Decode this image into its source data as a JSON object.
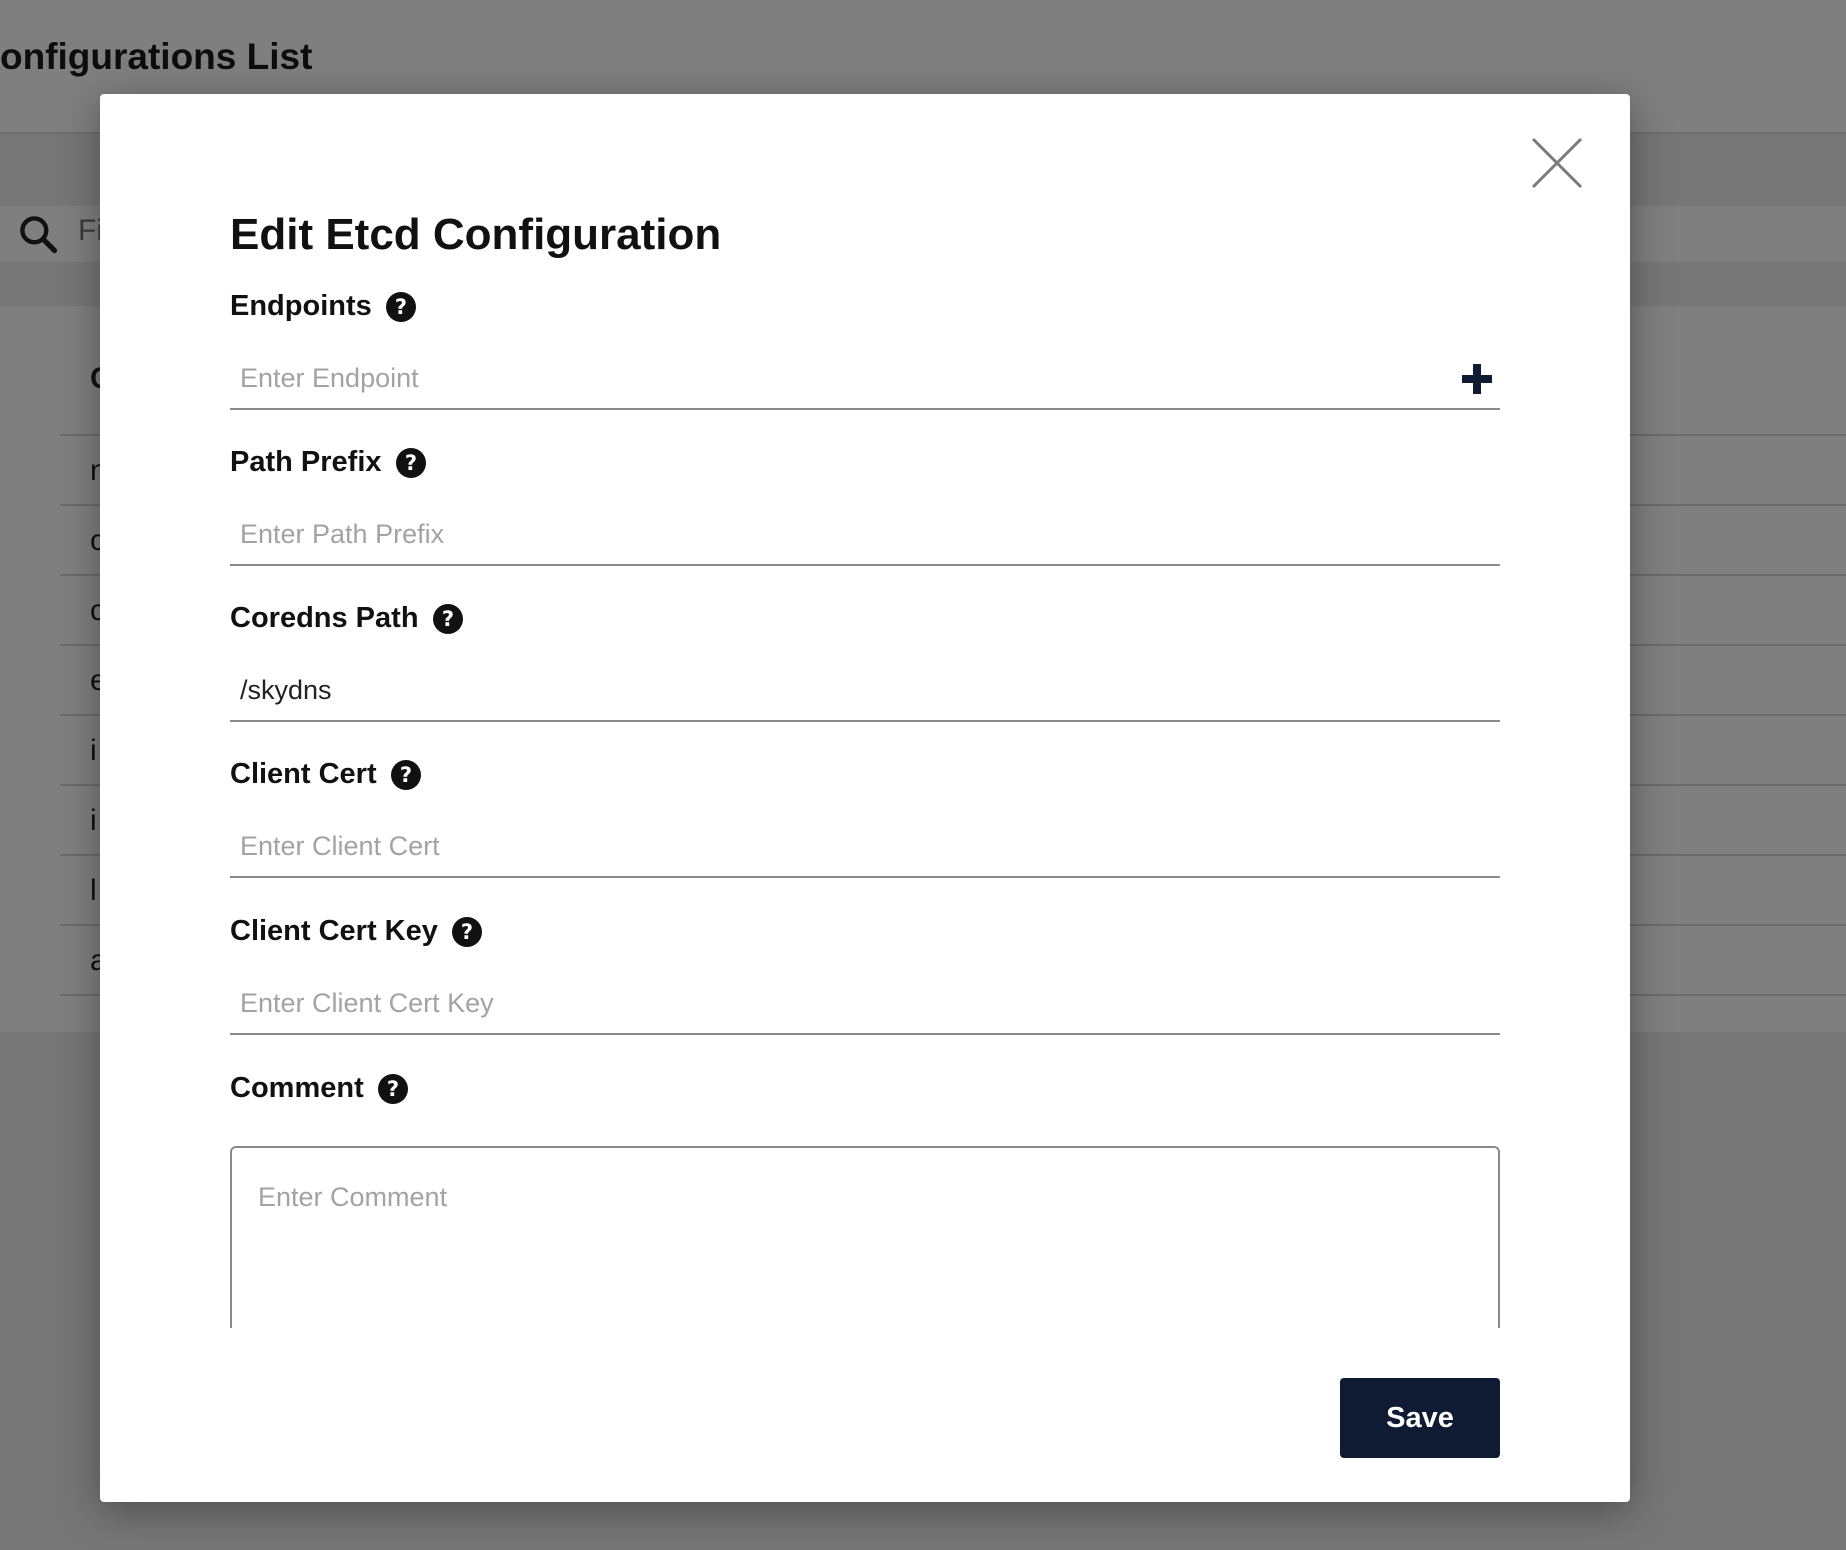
{
  "background": {
    "page_title": "onfigurations List",
    "search_placeholder": "Fi",
    "column_header": "C",
    "row_initials": [
      "n",
      "c",
      "c",
      "e",
      "i",
      "i",
      "l",
      "a"
    ]
  },
  "modal": {
    "title": "Edit Etcd Configuration",
    "close_icon": "close-icon",
    "save_label": "Save",
    "fields": {
      "endpoints": {
        "label": "Endpoints",
        "placeholder": "Enter Endpoint",
        "value": "",
        "add_icon": "plus-icon"
      },
      "path_prefix": {
        "label": "Path Prefix",
        "placeholder": "Enter Path Prefix",
        "value": ""
      },
      "coredns_path": {
        "label": "Coredns Path",
        "placeholder": "",
        "value": "/skydns"
      },
      "client_cert": {
        "label": "Client Cert",
        "placeholder": "Enter Client Cert",
        "value": ""
      },
      "client_cert_key": {
        "label": "Client Cert Key",
        "placeholder": "Enter Client Cert Key",
        "value": ""
      },
      "comment": {
        "label": "Comment",
        "placeholder": "Enter Comment",
        "value": ""
      }
    }
  },
  "colors": {
    "primary_button": "#0f1a33",
    "overlay": "rgba(0,0,0,0.5)",
    "placeholder": "#a3a3a3"
  }
}
